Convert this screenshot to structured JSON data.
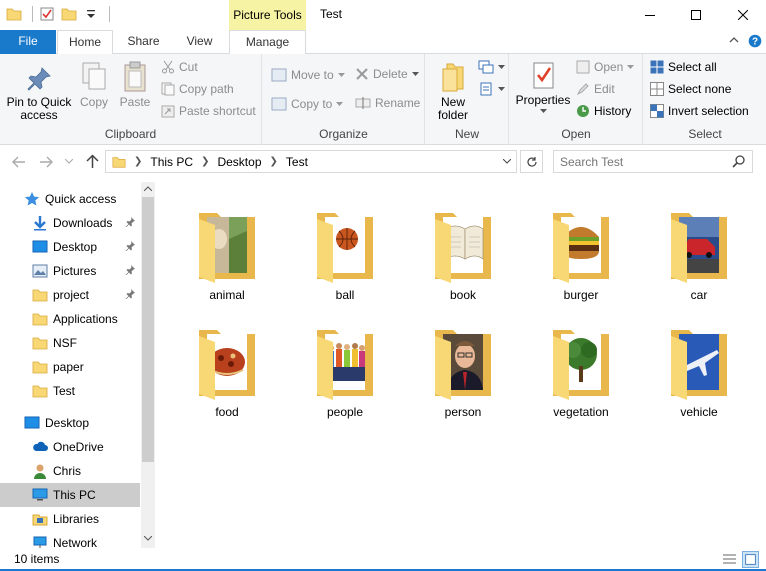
{
  "window": {
    "title": "Test",
    "context_tab_header": "Picture Tools"
  },
  "ribbon_tabs": [
    "File",
    "Home",
    "Share",
    "View",
    "Manage"
  ],
  "ribbon": {
    "clipboard": {
      "label": "Clipboard",
      "pin": "Pin to Quick access",
      "copy": "Copy",
      "paste": "Paste",
      "cut": "Cut",
      "copy_path": "Copy path",
      "paste_shortcut": "Paste shortcut"
    },
    "organize": {
      "label": "Organize",
      "move_to": "Move to",
      "copy_to": "Copy to",
      "delete": "Delete",
      "rename": "Rename"
    },
    "new": {
      "label": "New",
      "new_folder": "New folder"
    },
    "open": {
      "label": "Open",
      "properties": "Properties",
      "open": "Open",
      "edit": "Edit",
      "history": "History"
    },
    "select": {
      "label": "Select",
      "select_all": "Select all",
      "select_none": "Select none",
      "invert_selection": "Invert selection"
    }
  },
  "address": {
    "crumbs": [
      "This PC",
      "Desktop",
      "Test"
    ],
    "search_placeholder": "Search Test"
  },
  "nav_pane": [
    {
      "label": "Quick access",
      "icon": "star-icon"
    },
    {
      "label": "Downloads",
      "icon": "download-icon",
      "pinned": true
    },
    {
      "label": "Desktop",
      "icon": "desktop-icon",
      "pinned": true
    },
    {
      "label": "Pictures",
      "icon": "pictures-icon",
      "pinned": true
    },
    {
      "label": "project",
      "icon": "folder-icon",
      "pinned": true
    },
    {
      "label": "Applications",
      "icon": "folder-icon"
    },
    {
      "label": "NSF",
      "icon": "folder-icon"
    },
    {
      "label": "paper",
      "icon": "folder-icon"
    },
    {
      "label": "Test",
      "icon": "folder-icon"
    },
    {
      "label": "Desktop",
      "icon": "desktop-icon"
    },
    {
      "label": "OneDrive",
      "icon": "cloud-icon"
    },
    {
      "label": "Chris",
      "icon": "user-icon"
    },
    {
      "label": "This PC",
      "icon": "computer-icon",
      "selected": true
    },
    {
      "label": "Libraries",
      "icon": "libraries-icon"
    },
    {
      "label": "Network",
      "icon": "network-icon"
    }
  ],
  "folders": [
    {
      "name": "animal",
      "preview": "animal"
    },
    {
      "name": "ball",
      "preview": "ball"
    },
    {
      "name": "book",
      "preview": "book"
    },
    {
      "name": "burger",
      "preview": "burger"
    },
    {
      "name": "car",
      "preview": "car"
    },
    {
      "name": "food",
      "preview": "food"
    },
    {
      "name": "people",
      "preview": "people"
    },
    {
      "name": "person",
      "preview": "person"
    },
    {
      "name": "vegetation",
      "preview": "vegetation"
    },
    {
      "name": "vehicle",
      "preview": "vehicle"
    }
  ],
  "status": {
    "item_count": "10 items"
  },
  "colors": {
    "accent": "#1979ca",
    "context_tab": "#f7f3a5",
    "folder": "#f8d775",
    "folder_dark": "#e8b84c"
  }
}
